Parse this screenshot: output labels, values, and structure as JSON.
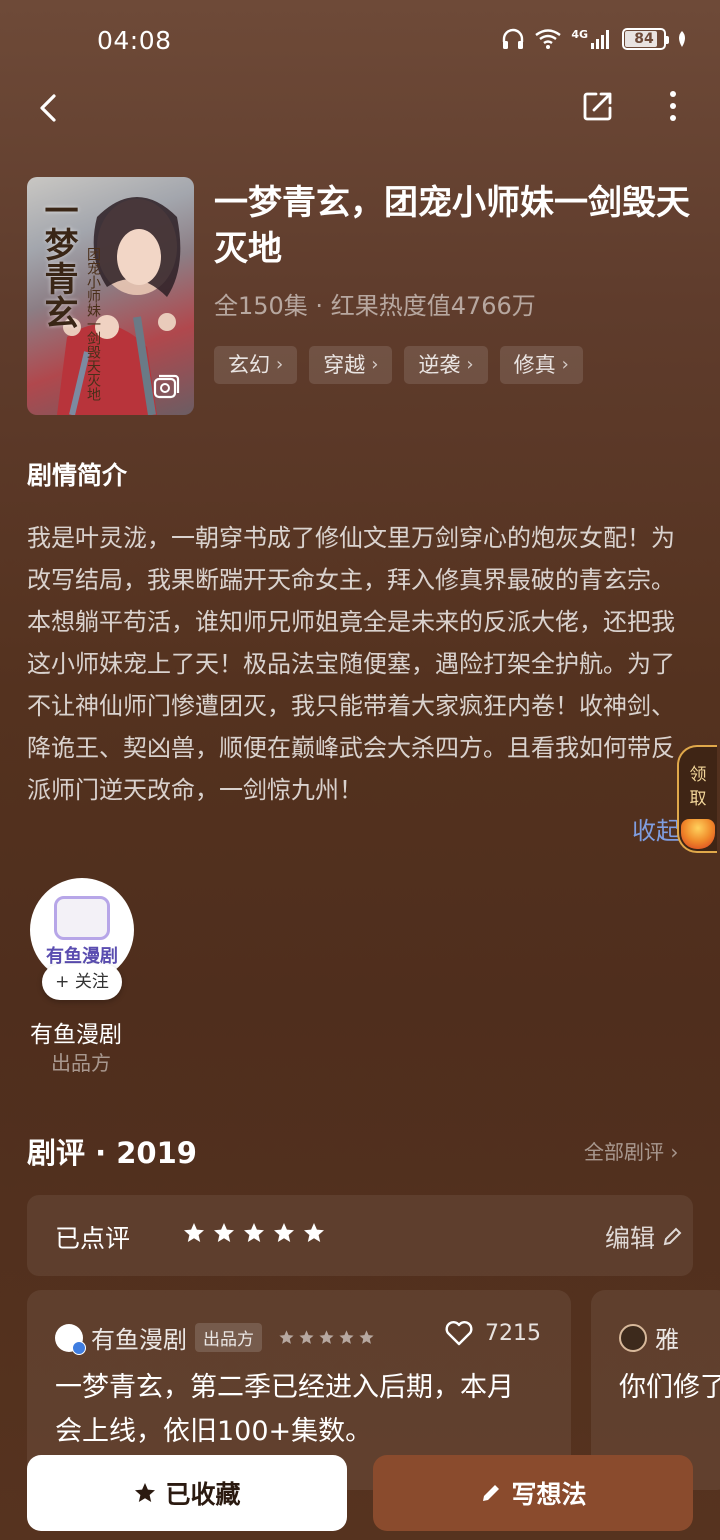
{
  "status": {
    "time": "04:08",
    "network": "4G",
    "battery": "84",
    "battery_level": 0.84
  },
  "nav": {
    "back_icon": "chevron-left-icon",
    "share_icon": "share-icon",
    "more_icon": "more-vertical-icon"
  },
  "drama": {
    "cover_title": "一梦青玄",
    "cover_subtitle": "团宠小师妹一剑毁天灭地",
    "title": "一梦青玄，团宠小师妹一剑毁天灭地",
    "meta": "全150集 · 红果热度值4766万",
    "tags": [
      "玄幻",
      "穿越",
      "逆袭",
      "修真"
    ]
  },
  "synopsis": {
    "heading": "剧情简介",
    "text": "我是叶灵泷，一朝穿书成了修仙文里万剑穿心的炮灰女配！为改写结局，我果断踹开天命女主，拜入修真界最破的青玄宗。本想躺平苟活，谁知师兄师姐竟全是未来的反派大佬，还把我这小师妹宠上了天！极品法宝随便塞，遇险打架全护航。为了不让神仙师门惨遭团灭，我只能带着大家疯狂内卷！收神剑、降诡王、契凶兽，顺便在巅峰武会大杀四方。且看我如何带反派师门逆天改命，一剑惊九州！",
    "collapse": "收起"
  },
  "reward": {
    "label": "领取"
  },
  "producer": {
    "avatar_text": "有鱼漫剧",
    "follow": "+ 关注",
    "name": "有鱼漫剧",
    "role": "出品方"
  },
  "reviews": {
    "title": "剧评 · 2019",
    "all": "全部剧评 ›",
    "my_rating_label": "已点评",
    "my_rating_stars": 5,
    "edit": "编辑",
    "items": [
      {
        "name": "有鱼漫剧",
        "badge": "出品方",
        "stars": 5,
        "likes": "7215",
        "text": "一梦青玄，第二季已经进入后期，本月会上线，依旧100+集数。"
      },
      {
        "name": "雅",
        "text": "你们修了。"
      }
    ]
  },
  "actions": {
    "favorite": "已收藏",
    "write": "写想法"
  }
}
